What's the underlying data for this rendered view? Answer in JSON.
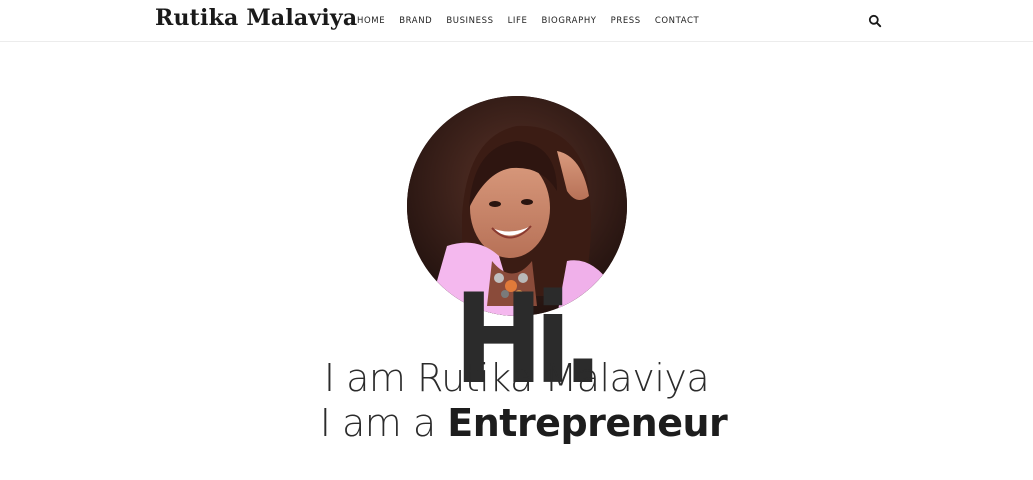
{
  "site": {
    "logo_text": "Rutika Malaviya"
  },
  "nav": {
    "items": [
      {
        "label": "HOME"
      },
      {
        "label": "BRAND"
      },
      {
        "label": "BUSINESS"
      },
      {
        "label": "LIFE"
      },
      {
        "label": "BIOGRAPHY"
      },
      {
        "label": "PRESS"
      },
      {
        "label": "CONTACT"
      }
    ],
    "search_icon": "search-icon"
  },
  "hero": {
    "portrait_icon": "portrait-photo",
    "greeting": "Hi.",
    "intro_prefix": "I am Rutika Malaviya",
    "role_prefix": "I am a",
    "role": "Entrepreneur"
  },
  "colors": {
    "text": "#2b2b2b",
    "jacket": "#f4b8ee",
    "background": "#ffffff",
    "header_border": "#ececec"
  }
}
